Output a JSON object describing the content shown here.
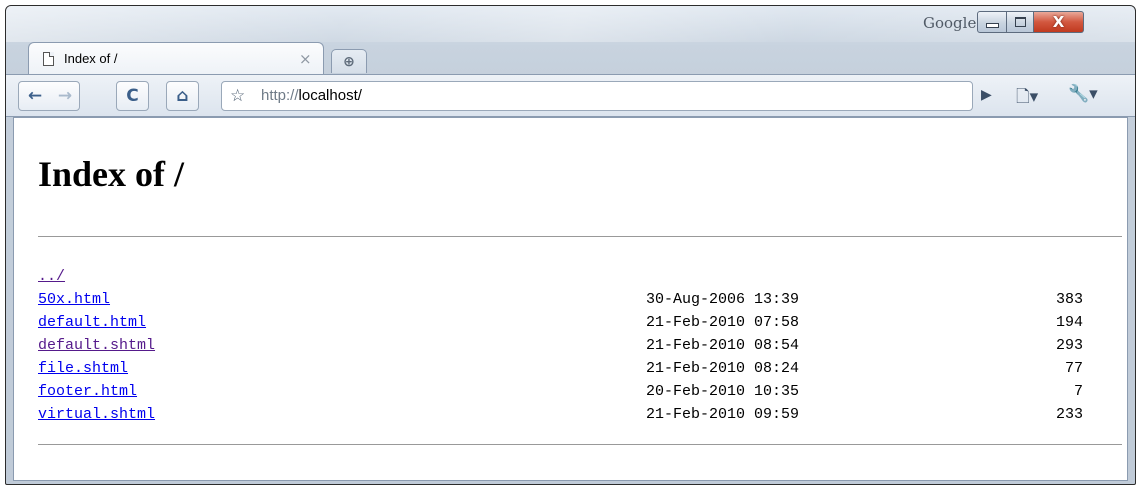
{
  "window": {
    "google_label": "Google",
    "close_glyph": "X"
  },
  "tab": {
    "title": "Index of /",
    "close_glyph": "×",
    "new_tab_glyph": "⊕"
  },
  "toolbar": {
    "back_icon": "←",
    "forward_icon": "→",
    "reload_icon": "C",
    "home_icon": "⌂",
    "star_icon": "☆",
    "url_protocol": "http://",
    "url_host": "localhost/",
    "go_icon": "▶",
    "page_menu_icon": "🗋▾",
    "wrench_menu_icon": "🔧▾"
  },
  "page": {
    "heading": "Index of /",
    "entries": [
      {
        "name": "../",
        "date": "",
        "size": "",
        "visited": true
      },
      {
        "name": "50x.html",
        "date": "30-Aug-2006 13:39",
        "size": "383",
        "visited": false
      },
      {
        "name": "default.html",
        "date": "21-Feb-2010 07:58",
        "size": "194",
        "visited": false
      },
      {
        "name": "default.shtml",
        "date": "21-Feb-2010 08:54",
        "size": "293",
        "visited": true
      },
      {
        "name": "file.shtml",
        "date": "21-Feb-2010 08:24",
        "size": "77",
        "visited": false
      },
      {
        "name": "footer.html",
        "date": "20-Feb-2010 10:35",
        "size": "7",
        "visited": false
      },
      {
        "name": "virtual.shtml",
        "date": "21-Feb-2010 09:59",
        "size": "233",
        "visited": false
      }
    ]
  },
  "colors": {
    "link": "#0000ee",
    "visited_link": "#551a8b",
    "close_button": "#c0391f"
  }
}
